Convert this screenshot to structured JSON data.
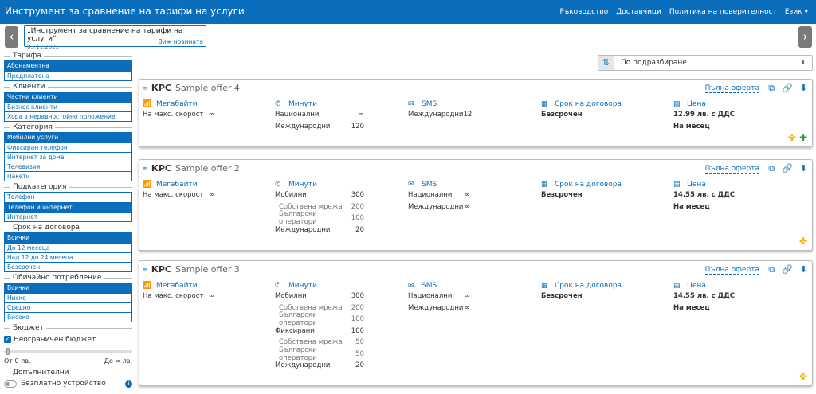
{
  "navbar": {
    "brand": "Инструмент за сравнение на тарифи на услуги",
    "links": [
      "Ръководство",
      "Доставчици",
      "Политика на поверителност",
      "Език ▾"
    ]
  },
  "news": {
    "title": "„Инструмент за сравнение на тарифи на услуги“",
    "date": "03.11.2021",
    "more": "Виж новината"
  },
  "filters": [
    {
      "heading": "Тарифа",
      "items": [
        {
          "label": "Абонаментна",
          "selected": true
        },
        {
          "label": "Предплатена",
          "selected": false
        }
      ]
    },
    {
      "heading": "Клиенти",
      "items": [
        {
          "label": "Частни клиенти",
          "selected": true
        },
        {
          "label": "Бизнес клиенти",
          "selected": false
        },
        {
          "label": "Хора в неравностойно положение",
          "selected": false
        }
      ]
    },
    {
      "heading": "Категория",
      "items": [
        {
          "label": "Мобилни услуги",
          "selected": true
        },
        {
          "label": "Фиксиран телефон",
          "selected": false
        },
        {
          "label": "Интернет за дома",
          "selected": false
        },
        {
          "label": "Телевизия",
          "selected": false
        },
        {
          "label": "Пакети",
          "selected": false
        }
      ]
    },
    {
      "heading": "Подкатегория",
      "items": [
        {
          "label": "Телефон",
          "selected": false
        },
        {
          "label": "Телефон и интернет",
          "selected": true
        },
        {
          "label": "Интернет",
          "selected": false
        }
      ]
    },
    {
      "heading": "Срок на договора",
      "items": [
        {
          "label": "Всички",
          "selected": true
        },
        {
          "label": "До 12 месеца",
          "selected": false
        },
        {
          "label": "Над 12 до 24 месеца",
          "selected": false
        },
        {
          "label": "Безсрочен",
          "selected": false
        }
      ]
    },
    {
      "heading": "Обичайно потребление",
      "items": [
        {
          "label": "Всички",
          "selected": true
        },
        {
          "label": "Ниско",
          "selected": false
        },
        {
          "label": "Средно",
          "selected": false
        },
        {
          "label": "Високо",
          "selected": false
        }
      ]
    }
  ],
  "budget": {
    "heading": "Бюджет",
    "unlimited_label": "Неограничен бюджет",
    "from_label": "От 0 лв.",
    "to_label": "До ∞ лв."
  },
  "extras": {
    "heading": "Допълнителни",
    "free_device_label": "Безплатно устройство"
  },
  "sort": {
    "selected": "По подразбиране"
  },
  "labels": {
    "col_data": "Мегабайти",
    "col_minutes": "Минути",
    "col_sms": "SMS",
    "col_term": "Срок на договора",
    "col_price": "Цена",
    "full_offer": "Пълна оферта"
  },
  "offers": [
    {
      "provider": "КРС",
      "title": "Sample offer 4",
      "data": [
        {
          "label": "На макс. скорост",
          "value": "∞"
        }
      ],
      "minutes": [
        {
          "label": "Национални",
          "value": "∞",
          "sub": false
        },
        {
          "label": "Международни",
          "value": "120",
          "sub": false
        }
      ],
      "sms": [
        {
          "label": "Международни",
          "value": "12"
        }
      ],
      "term": "Безсрочен",
      "price": "12.99 лв. с ДДС",
      "period": "На месец"
    },
    {
      "provider": "КРС",
      "title": "Sample offer 2",
      "data": [
        {
          "label": "На макс. скорост",
          "value": "∞"
        }
      ],
      "minutes": [
        {
          "label": "Мобилни",
          "value": "300",
          "sub": false
        },
        {
          "label": "Собствена мрежа",
          "value": "200",
          "sub": true
        },
        {
          "label": "Български оператори",
          "value": "100",
          "sub": true
        },
        {
          "label": "Международни",
          "value": "20",
          "sub": false
        }
      ],
      "sms": [
        {
          "label": "Национални",
          "value": "∞"
        },
        {
          "label": "Международни",
          "value": "∞"
        }
      ],
      "term": "Безсрочен",
      "price": "14.55 лв. с ДДС",
      "period": "На месец"
    },
    {
      "provider": "КРС",
      "title": "Sample offer 3",
      "data": [
        {
          "label": "На макс. скорост",
          "value": "∞"
        }
      ],
      "minutes": [
        {
          "label": "Мобилни",
          "value": "300",
          "sub": false
        },
        {
          "label": "Собствена мрежа",
          "value": "200",
          "sub": true
        },
        {
          "label": "Български оператори",
          "value": "100",
          "sub": true
        },
        {
          "label": "Фиксирани",
          "value": "100",
          "sub": false
        },
        {
          "label": "Собствена мрежа",
          "value": "50",
          "sub": true
        },
        {
          "label": "Български оператори",
          "value": "50",
          "sub": true
        },
        {
          "label": "Международни",
          "value": "20",
          "sub": false
        }
      ],
      "sms": [
        {
          "label": "Национални",
          "value": "∞"
        },
        {
          "label": "Международни",
          "value": "∞"
        }
      ],
      "term": "Безсрочен",
      "price": "14.55 лв. с ДДС",
      "period": "На месец"
    }
  ]
}
